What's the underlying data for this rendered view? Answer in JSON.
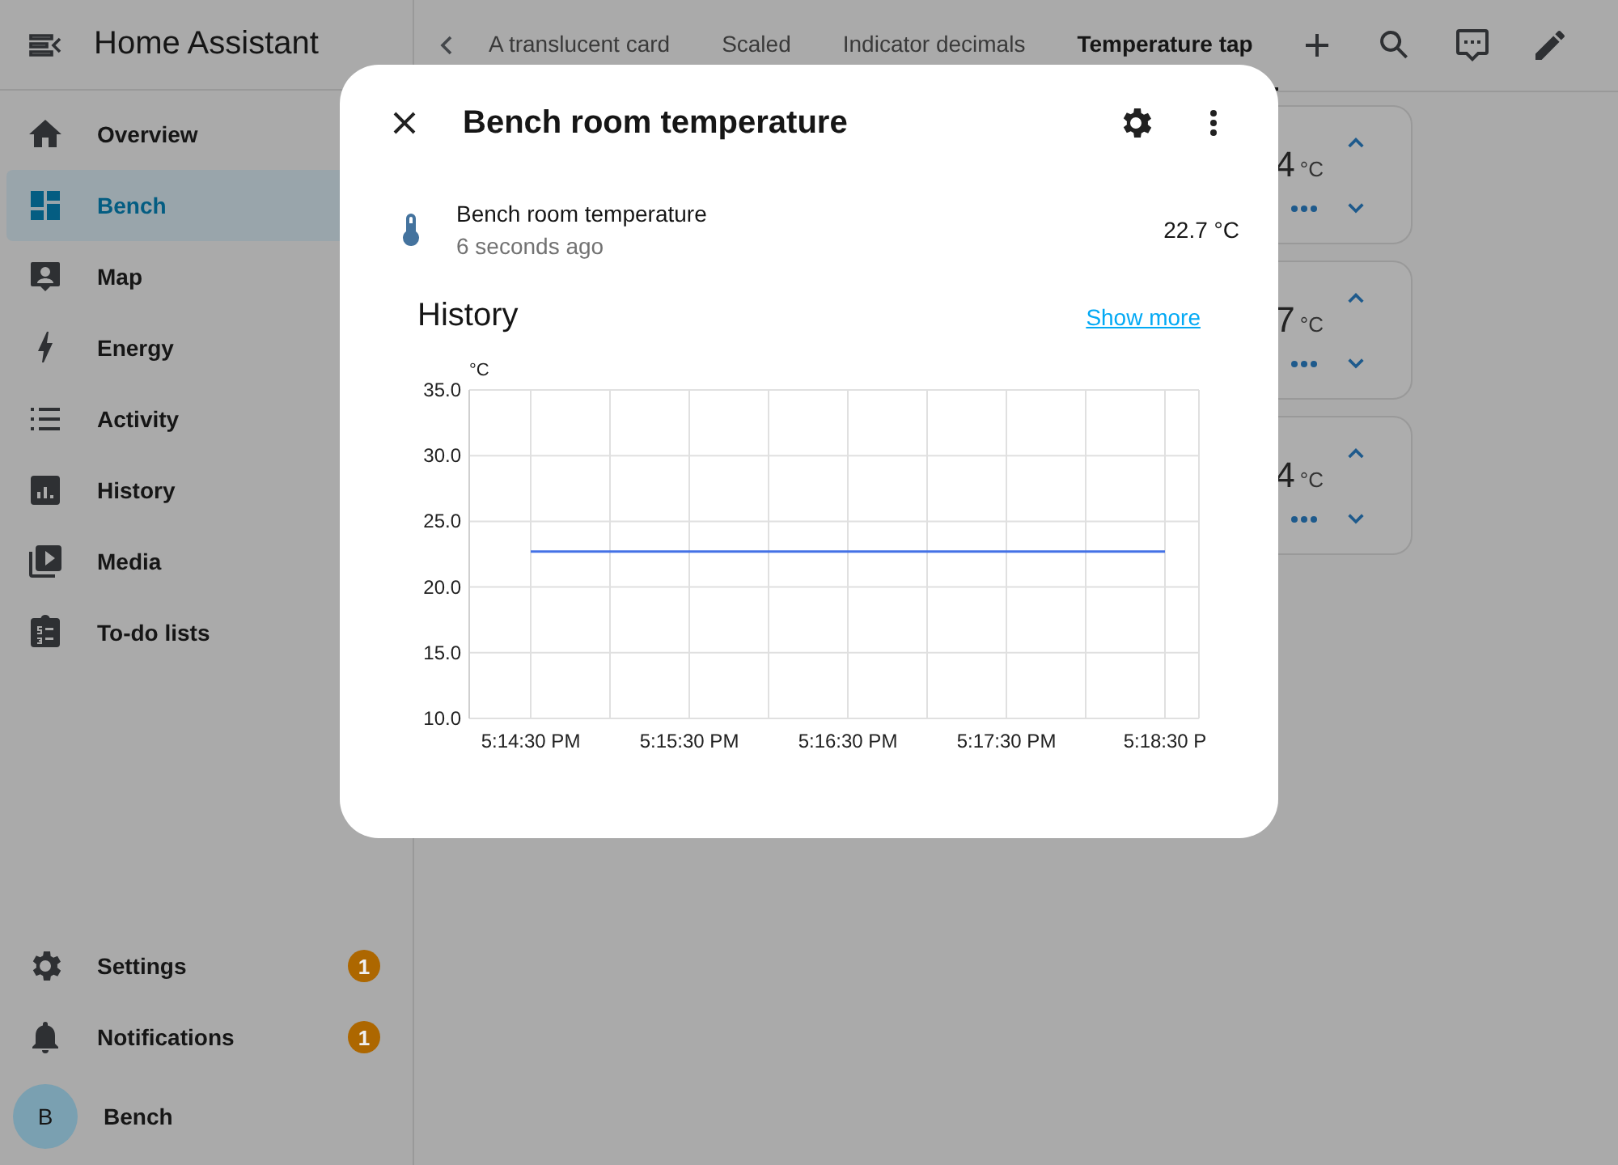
{
  "sidebar": {
    "title": "Home Assistant",
    "items": [
      {
        "label": "Overview",
        "selected": false
      },
      {
        "label": "Bench",
        "selected": true
      },
      {
        "label": "Map",
        "selected": false
      },
      {
        "label": "Energy",
        "selected": false
      },
      {
        "label": "Activity",
        "selected": false
      },
      {
        "label": "History",
        "selected": false
      },
      {
        "label": "Media",
        "selected": false
      },
      {
        "label": "To-do lists",
        "selected": false
      }
    ],
    "bottom_items": [
      {
        "label": "Settings",
        "badge": "1"
      },
      {
        "label": "Notifications",
        "badge": "1"
      }
    ],
    "user": {
      "initial": "B",
      "name": "Bench"
    }
  },
  "topbar": {
    "tabs": [
      {
        "label": "A translucent card",
        "selected": false
      },
      {
        "label": "Scaled",
        "selected": false
      },
      {
        "label": "Indicator decimals",
        "selected": false
      },
      {
        "label": "Temperature tap",
        "selected": true
      }
    ]
  },
  "cards": [
    {
      "value": "4",
      "unit": "°C"
    },
    {
      "value": "7",
      "unit": "°C"
    },
    {
      "value": "4",
      "unit": "°C"
    }
  ],
  "dialog": {
    "title": "Bench room temperature",
    "entity": {
      "name": "Bench room temperature",
      "last_changed": "6 seconds ago",
      "state": "22.7 °C"
    },
    "history": {
      "title": "History",
      "link": "Show more",
      "chart_data": {
        "type": "line",
        "grid": true,
        "ylabel": "°C",
        "ylim": [
          10,
          35
        ],
        "yticks": [
          {
            "value": 10,
            "label": "10.0"
          },
          {
            "value": 15,
            "label": "15.0"
          },
          {
            "value": 20,
            "label": "20.0"
          },
          {
            "value": 25,
            "label": "25.0"
          },
          {
            "value": 30,
            "label": "30.0"
          },
          {
            "value": 35,
            "label": "35.0"
          }
        ],
        "categories": [
          "5:14:30 PM",
          null,
          "5:15:30 PM",
          null,
          "5:16:30 PM",
          null,
          "5:17:30 PM",
          null,
          "5:18:30 P"
        ],
        "series": [
          {
            "color": "#4472e6",
            "values": [
              22.7,
              22.7,
              22.7,
              22.7,
              22.7,
              22.7,
              22.7,
              22.7,
              22.7
            ]
          }
        ]
      }
    }
  }
}
